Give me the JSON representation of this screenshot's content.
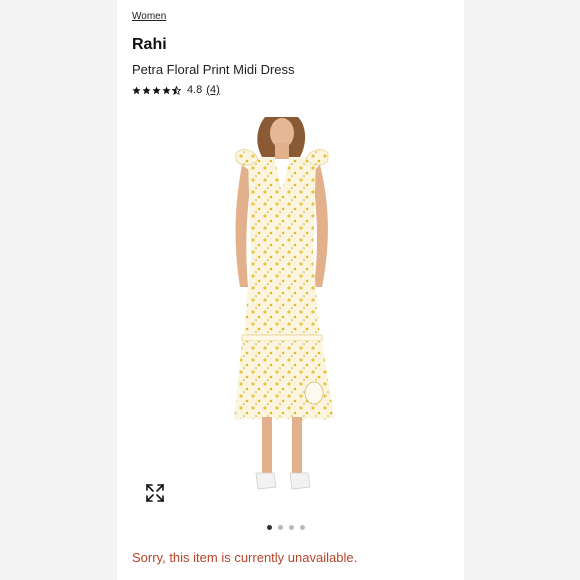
{
  "breadcrumb": "Women",
  "brand": "Rahi",
  "product_name": "Petra Floral Print Midi Dress",
  "rating": {
    "stars": 4.5,
    "value": "4.8",
    "count": "(4)"
  },
  "photo": {
    "icon": "dress-photo"
  },
  "carousel": {
    "total": 4,
    "active": 1
  },
  "status_message": "Sorry, this item is currently unavailable.",
  "colors": {
    "accent": "#b8452a",
    "dress_base": "#faf3dc",
    "dress_print": "#e8c53a"
  }
}
